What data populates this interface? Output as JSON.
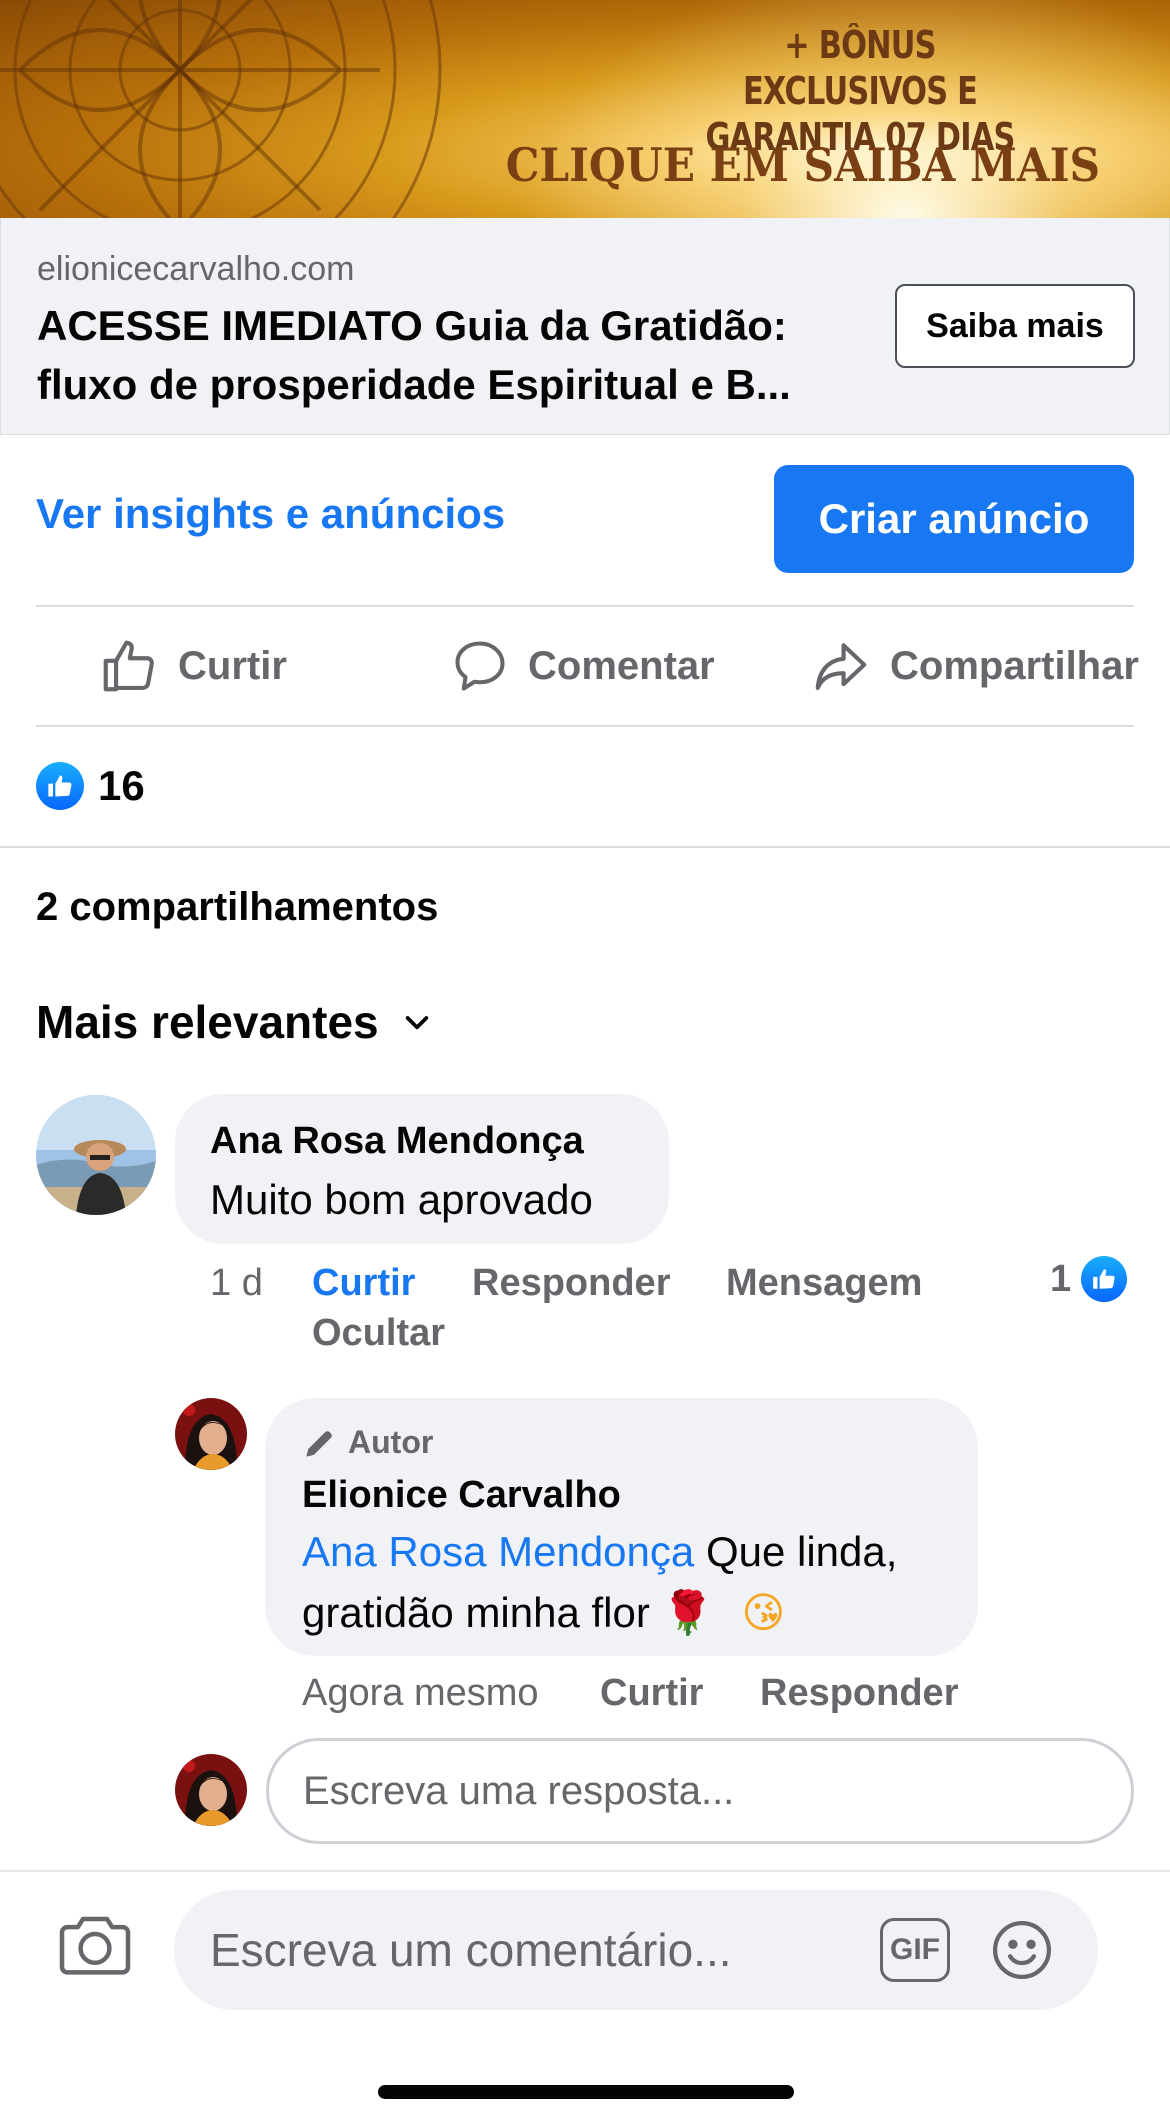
{
  "banner": {
    "bonus_line1": "+ BÔNUS EXCLUSIVOS E",
    "bonus_line2": "GARANTIA 07 DIAS",
    "cta": "CLIQUE EM SAIBA MAIS"
  },
  "link_card": {
    "domain": "elionicecarvalho.com",
    "title": "ACESSE IMEDIATO Guia da Gratidão: fluxo de prosperidade Espiritual e B...",
    "button": "Saiba mais"
  },
  "ads": {
    "insights_link": "Ver insights e anúncios",
    "create_ad_button": "Criar anúncio"
  },
  "actions": {
    "like": "Curtir",
    "comment": "Comentar",
    "share": "Compartilhar"
  },
  "reactions": {
    "count": "16"
  },
  "shares": "2 compartilhamentos",
  "sort": {
    "label": "Mais relevantes"
  },
  "comments": [
    {
      "author": "Ana Rosa Mendonça",
      "text": "Muito bom aprovado",
      "time": "1 d",
      "like": "Curtir",
      "reply": "Responder",
      "message": "Mensagem",
      "hide": "Ocultar",
      "likes": "1",
      "replies": [
        {
          "badge": "Autor",
          "author": "Elionice Carvalho",
          "mention": "Ana Rosa Mendonça",
          "text_line1": "Que linda,",
          "text_line2": "gratidão minha flor",
          "emoji_rose": "🌹",
          "emoji_kiss": "😘",
          "time": "Agora mesmo",
          "like": "Curtir",
          "reply": "Responder"
        }
      ]
    }
  ],
  "reply_input": {
    "placeholder": "Escreva uma resposta..."
  },
  "composer": {
    "placeholder": "Escreva um comentário...",
    "gif_label": "GIF"
  },
  "colors": {
    "accent": "#1877f2",
    "secondary_text": "#65676b",
    "bubble": "#f0f2f5"
  }
}
